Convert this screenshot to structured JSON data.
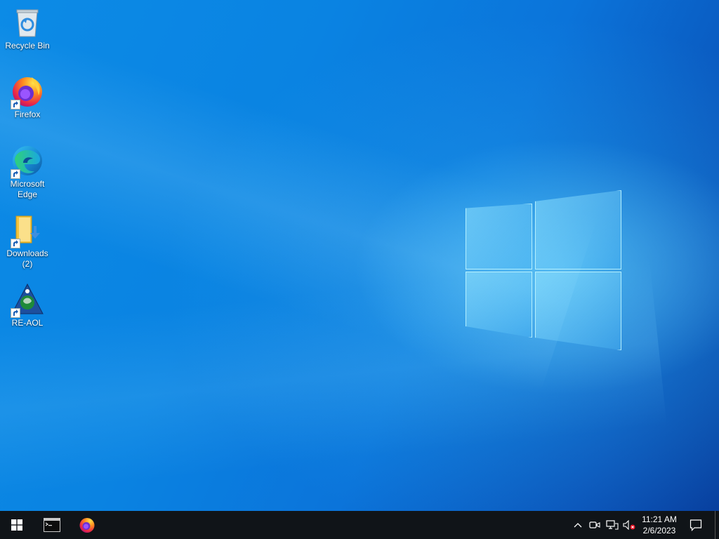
{
  "desktop": {
    "icons": [
      {
        "label": "Recycle Bin",
        "icon": "recycle-bin-icon"
      },
      {
        "label": "Firefox",
        "icon": "firefox-icon"
      },
      {
        "label": "Microsoft Edge",
        "icon": "edge-icon"
      },
      {
        "label": "Downloads (2)",
        "icon": "downloads-folder-icon"
      },
      {
        "label": "RE-AOL",
        "icon": "re-aol-icon"
      }
    ]
  },
  "taskbar": {
    "start_icon": "windows-start-icon",
    "apps": [
      {
        "name": "Command Prompt",
        "icon": "terminal-icon"
      },
      {
        "name": "Firefox",
        "icon": "firefox-icon"
      }
    ],
    "tray": {
      "icons": [
        "chevron-up-icon",
        "meet-now-icon",
        "network-icon",
        "volume-muted-icon"
      ],
      "time": "11:21 AM",
      "date": "2/6/2023"
    },
    "notification_icon": "action-center-icon"
  },
  "colors": {
    "taskbar": "#101418",
    "desktop_blue": "#0a83e2"
  }
}
